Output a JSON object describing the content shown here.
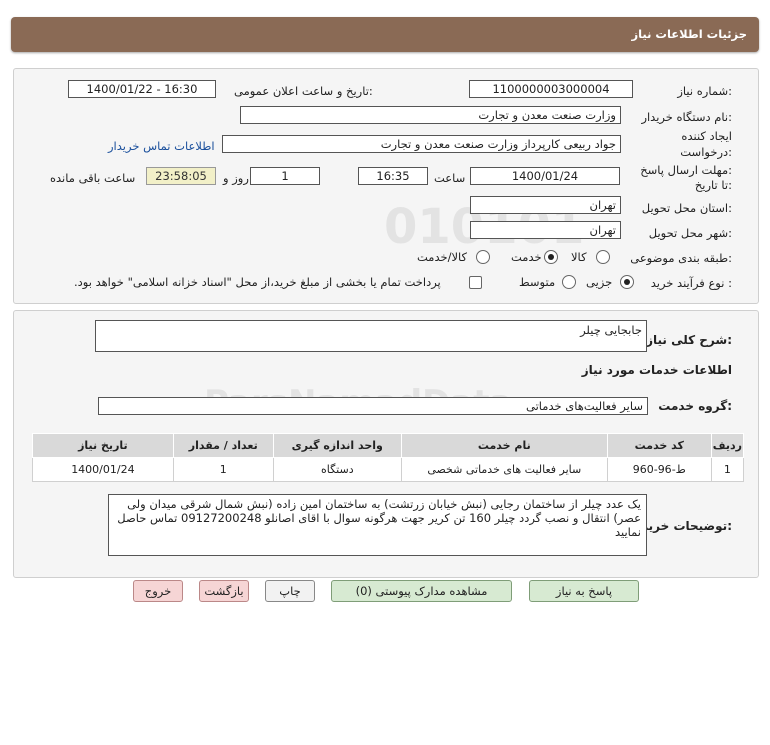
{
  "header": {
    "title": "جزئیات اطلاعات نیاز"
  },
  "request": {
    "number_label": "شماره نیاز:",
    "number_value": "1100000003000004",
    "announce_label": "تاریخ و ساعت اعلان عمومی:",
    "announce_value": "1400/01/22 - 16:30",
    "buyer_org_label": "نام دستگاه خریدار:",
    "buyer_org_value": "وزارت صنعت معدن و تجارت",
    "creator_label_1": "ایجاد کننده",
    "creator_label_2": "درخواست:",
    "creator_value": "جواد ربیعی کارپرداز وزارت صنعت معدن و تجارت",
    "contact_link": "اطلاعات تماس خریدار",
    "deadline_label_1": "مهلت ارسال پاسخ:",
    "deadline_label_2": "تا تاریخ:",
    "deadline_date": "1400/01/24",
    "time_label": "ساعت",
    "deadline_time": "16:35",
    "days_value": "1",
    "days_label": "روز و",
    "remaining_time": "23:58:05",
    "remaining_label": "ساعت باقی مانده",
    "province_label": "استان محل تحویل:",
    "province_value": "تهران",
    "city_label": "شهر محل تحویل:",
    "city_value": "تهران",
    "category_label": "طبقه بندی موضوعی:",
    "category_options": {
      "goods": "کالا",
      "service": "خدمت",
      "goods_service": "کالا/خدمت"
    },
    "category_selected": "service",
    "process_label": "نوع فرآیند خرید :",
    "process_options": {
      "small": "جزیی",
      "medium": "متوسط"
    },
    "process_selected": "small",
    "payment_note": "پرداخت تمام یا بخشی از مبلغ خرید،از محل \"اسناد خزانه اسلامی\" خواهد بود."
  },
  "details": {
    "summary_label": "شرح کلی نیاز:",
    "summary_value": "جابجایی چیلر",
    "services_info_title": "اطلاعات خدمات مورد نیاز",
    "service_group_label": "گروه خدمت:",
    "service_group_value": "سایر فعالیت‌های خدماتی",
    "table": {
      "headers": [
        "ردیف",
        "کد خدمت",
        "نام خدمت",
        "واحد اندازه گیری",
        "تعداد / مقدار",
        "تاریخ نیاز"
      ],
      "rows": [
        [
          "1",
          "ط-96-960",
          "سایر فعالیت های خدماتی شخصی",
          "دستگاه",
          "1",
          "1400/01/24"
        ]
      ]
    },
    "buyer_notes_label": "توضیحات خریدار:",
    "buyer_notes_value": "یک عدد چیلر از ساختمان رجایی (نبش خیابان زرتشت) به ساختمان امین زاده (نبش شمال شرقی میدان ولی عصر) انتقال و نصب گردد چیلر 160 تن کریر   جهت هرگونه سوال با اقای اصانلو 09127200248 تماس حاصل نمایید"
  },
  "buttons": {
    "reply": "پاسخ به نیاز",
    "attachments": "مشاهده مدارک پیوستی (0)",
    "print": "چاپ",
    "back": "بازگشت",
    "exit": "خروج"
  }
}
